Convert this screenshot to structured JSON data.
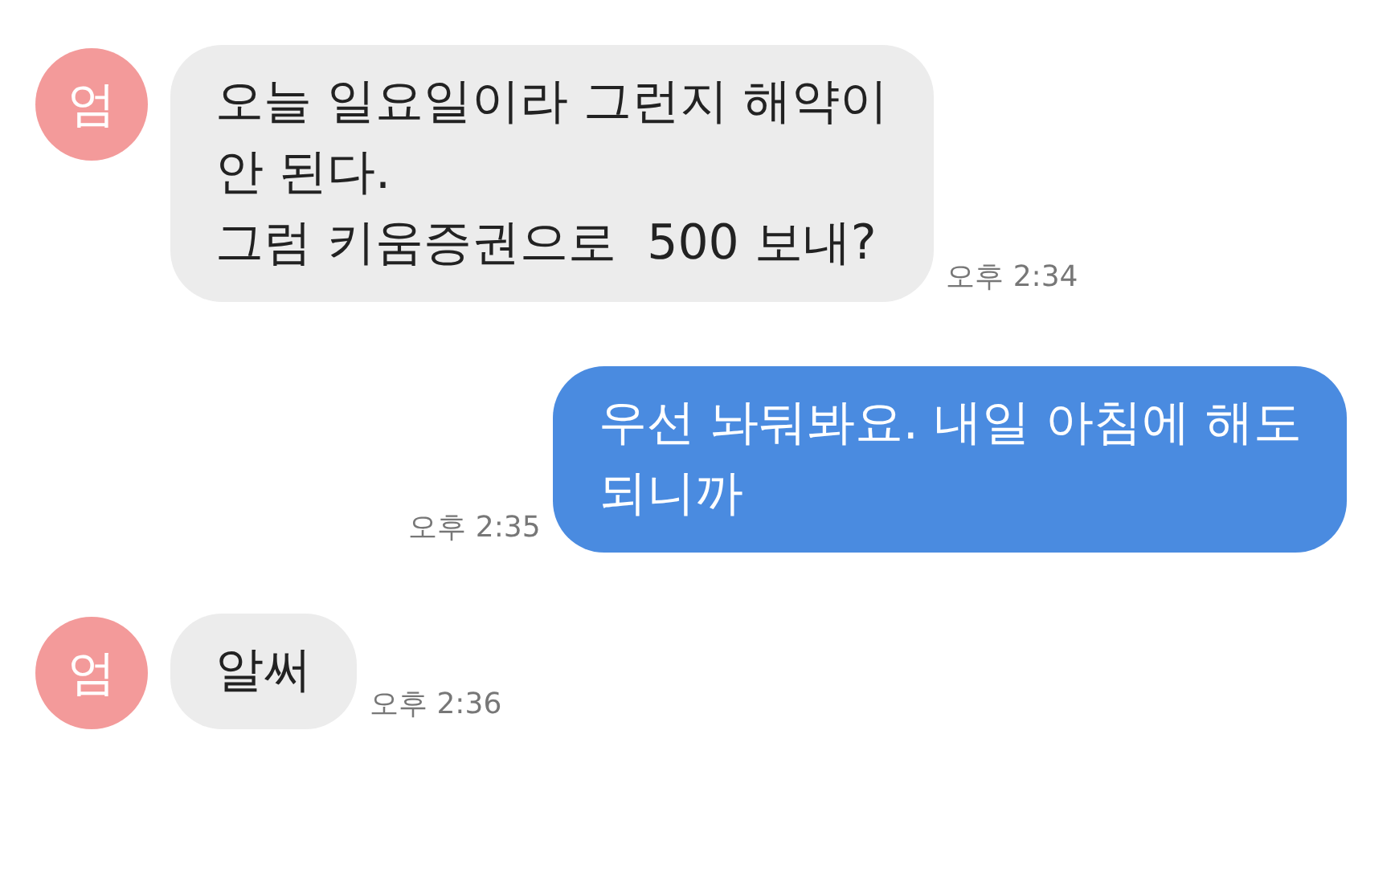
{
  "messages": [
    {
      "kind": "received",
      "avatar": "엄",
      "lines": [
        "오늘 일요일이라 그런지 해약이",
        "안 된다.",
        "그럼 키움증권으로  500 보내?"
      ],
      "time": "오후 2:34"
    },
    {
      "kind": "sent",
      "lines": [
        "우선 놔둬봐요. 내일 아침에 해도",
        "되니까"
      ],
      "time": "오후 2:35"
    },
    {
      "kind": "received",
      "avatar": "엄",
      "lines": [
        "알써"
      ],
      "time": "오후 2:36"
    }
  ]
}
